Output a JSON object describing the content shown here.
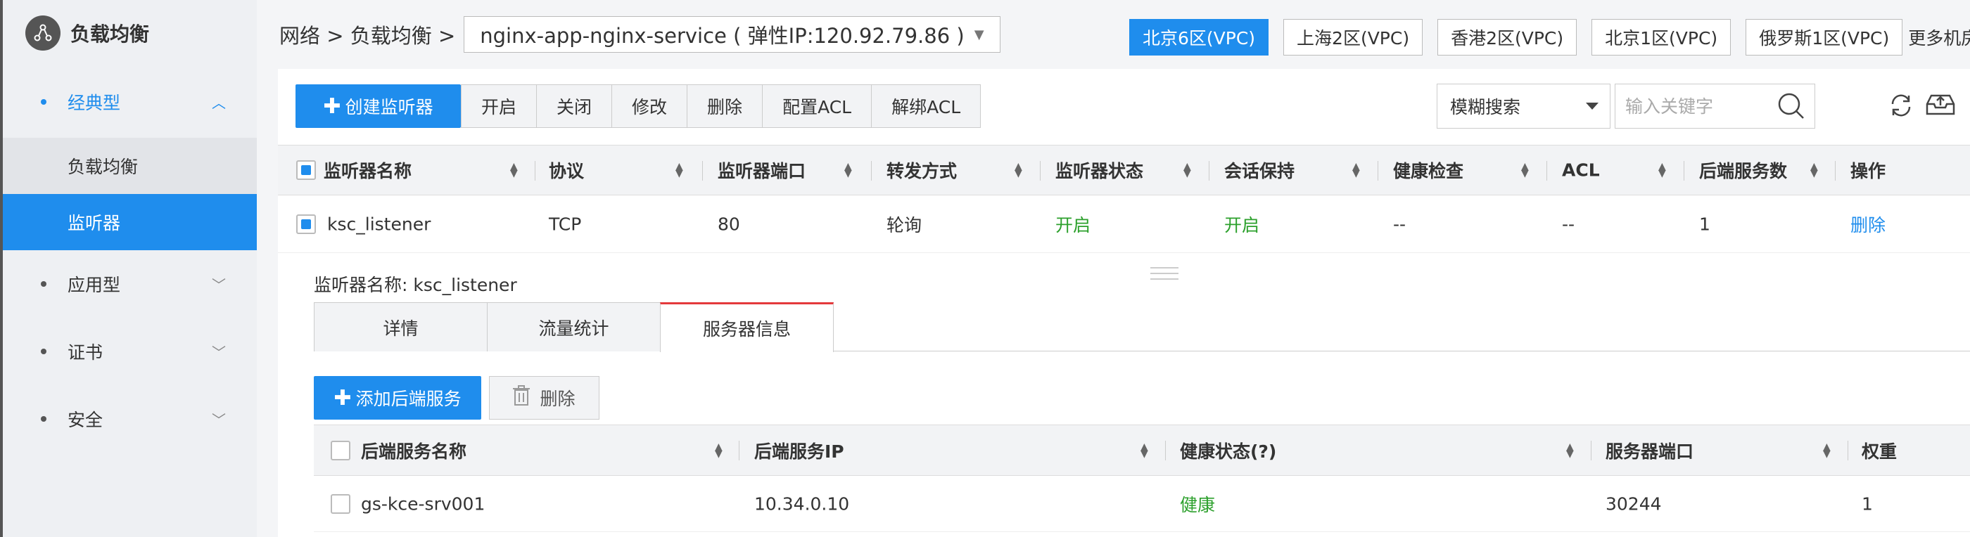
{
  "sidebar": {
    "title": "负载均衡",
    "groups": [
      {
        "label": "经典型",
        "expanded": true,
        "items": [
          "负载均衡",
          "监听器"
        ],
        "selected": "监听器"
      },
      {
        "label": "应用型"
      },
      {
        "label": "证书"
      },
      {
        "label": "安全"
      }
    ]
  },
  "topbar": {
    "breadcrumb": "网络 > 负载均衡 >",
    "service": "nginx-app-nginx-service ( 弹性IP:120.92.79.86 )",
    "regions": [
      "北京6区(VPC)",
      "上海2区(VPC)",
      "香港2区(VPC)",
      "北京1区(VPC)",
      "俄罗斯1区(VPC)"
    ],
    "active_region": "北京6区(VPC)",
    "more_rooms": "更多机房"
  },
  "toolbar": {
    "create_label": "创建监听器",
    "group": [
      "开启",
      "关闭",
      "修改",
      "删除",
      "配置ACL",
      "解绑ACL"
    ],
    "search_type": "模糊搜索",
    "search_placeholder": "输入关键字"
  },
  "listener_table": {
    "columns": [
      "监听器名称",
      "协议",
      "监听器端口",
      "转发方式",
      "监听器状态",
      "会话保持",
      "健康检查",
      "ACL",
      "后端服务数",
      "操作"
    ],
    "rows": [
      {
        "name": "ksc_listener",
        "protocol": "TCP",
        "port": "80",
        "forward": "轮询",
        "status": "开启",
        "session": "开启",
        "health": "--",
        "acl": "--",
        "backends": "1",
        "action": "删除"
      }
    ]
  },
  "detail": {
    "title": "监听器名称: ksc_listener",
    "tabs": [
      "详情",
      "流量统计",
      "服务器信息"
    ],
    "active_tab": "服务器信息",
    "add_label": "添加后端服务",
    "delete_label": "删除",
    "server_table": {
      "columns": [
        "后端服务名称",
        "后端服务IP",
        "健康状态(?)",
        "服务器端口",
        "权重"
      ],
      "rows": [
        {
          "name": "gs-kce-srv001",
          "ip": "10.34.0.10",
          "health": "健康",
          "port": "30244",
          "weight": "1"
        }
      ]
    }
  },
  "colors": {
    "accent": "#1f8ded",
    "success": "#2ca02c",
    "tab_highlight": "#e4393c"
  }
}
